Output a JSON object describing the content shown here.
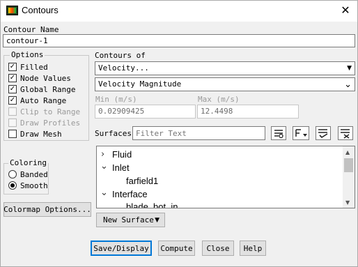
{
  "window": {
    "title": "Contours",
    "close_glyph": "✕"
  },
  "contour_name": {
    "label": "Contour Name",
    "value": "contour-1"
  },
  "options": {
    "title": "Options",
    "items": [
      {
        "label": "Filled",
        "checked": true,
        "enabled": true
      },
      {
        "label": "Node Values",
        "checked": true,
        "enabled": true
      },
      {
        "label": "Global Range",
        "checked": true,
        "enabled": true
      },
      {
        "label": "Auto Range",
        "checked": true,
        "enabled": true
      },
      {
        "label": "Clip to Range",
        "checked": false,
        "enabled": false
      },
      {
        "label": "Draw Profiles",
        "checked": false,
        "enabled": false
      },
      {
        "label": "Draw Mesh",
        "checked": false,
        "enabled": true
      }
    ]
  },
  "contours_of": {
    "label": "Contours of",
    "category": "Velocity...",
    "quantity": "Velocity Magnitude",
    "min_label": "Min (m/s)",
    "min_value": "0.02909425",
    "max_label": "Max (m/s)",
    "max_value": "12.4498"
  },
  "surfaces": {
    "label": "Surfaces",
    "filter_placeholder": "Filter Text",
    "toolbar_icons": [
      "select-all-icon",
      "filter-type-icon",
      "check-selected-icon",
      "deselect-all-icon"
    ],
    "tree": [
      {
        "label": "Fluid",
        "expanded": false,
        "level": 0
      },
      {
        "label": "Inlet",
        "expanded": true,
        "level": 0
      },
      {
        "label": "farfield1",
        "level": 1
      },
      {
        "label": "Interface",
        "expanded": true,
        "level": 0
      },
      {
        "label": "blade_bot_in",
        "level": 1
      }
    ]
  },
  "coloring": {
    "title": "Coloring",
    "options": [
      {
        "label": "Banded",
        "selected": false
      },
      {
        "label": "Smooth",
        "selected": true
      }
    ]
  },
  "buttons": {
    "colormap": "Colormap Options...",
    "new_surface": "New Surface",
    "save_display": "Save/Display",
    "compute": "Compute",
    "close": "Close",
    "help": "Help"
  },
  "glyphs": {
    "check": "✓",
    "arrow_down": "▼",
    "chevron_down": "⌄",
    "tree_collapsed": "›",
    "tree_expanded": "⌄"
  }
}
